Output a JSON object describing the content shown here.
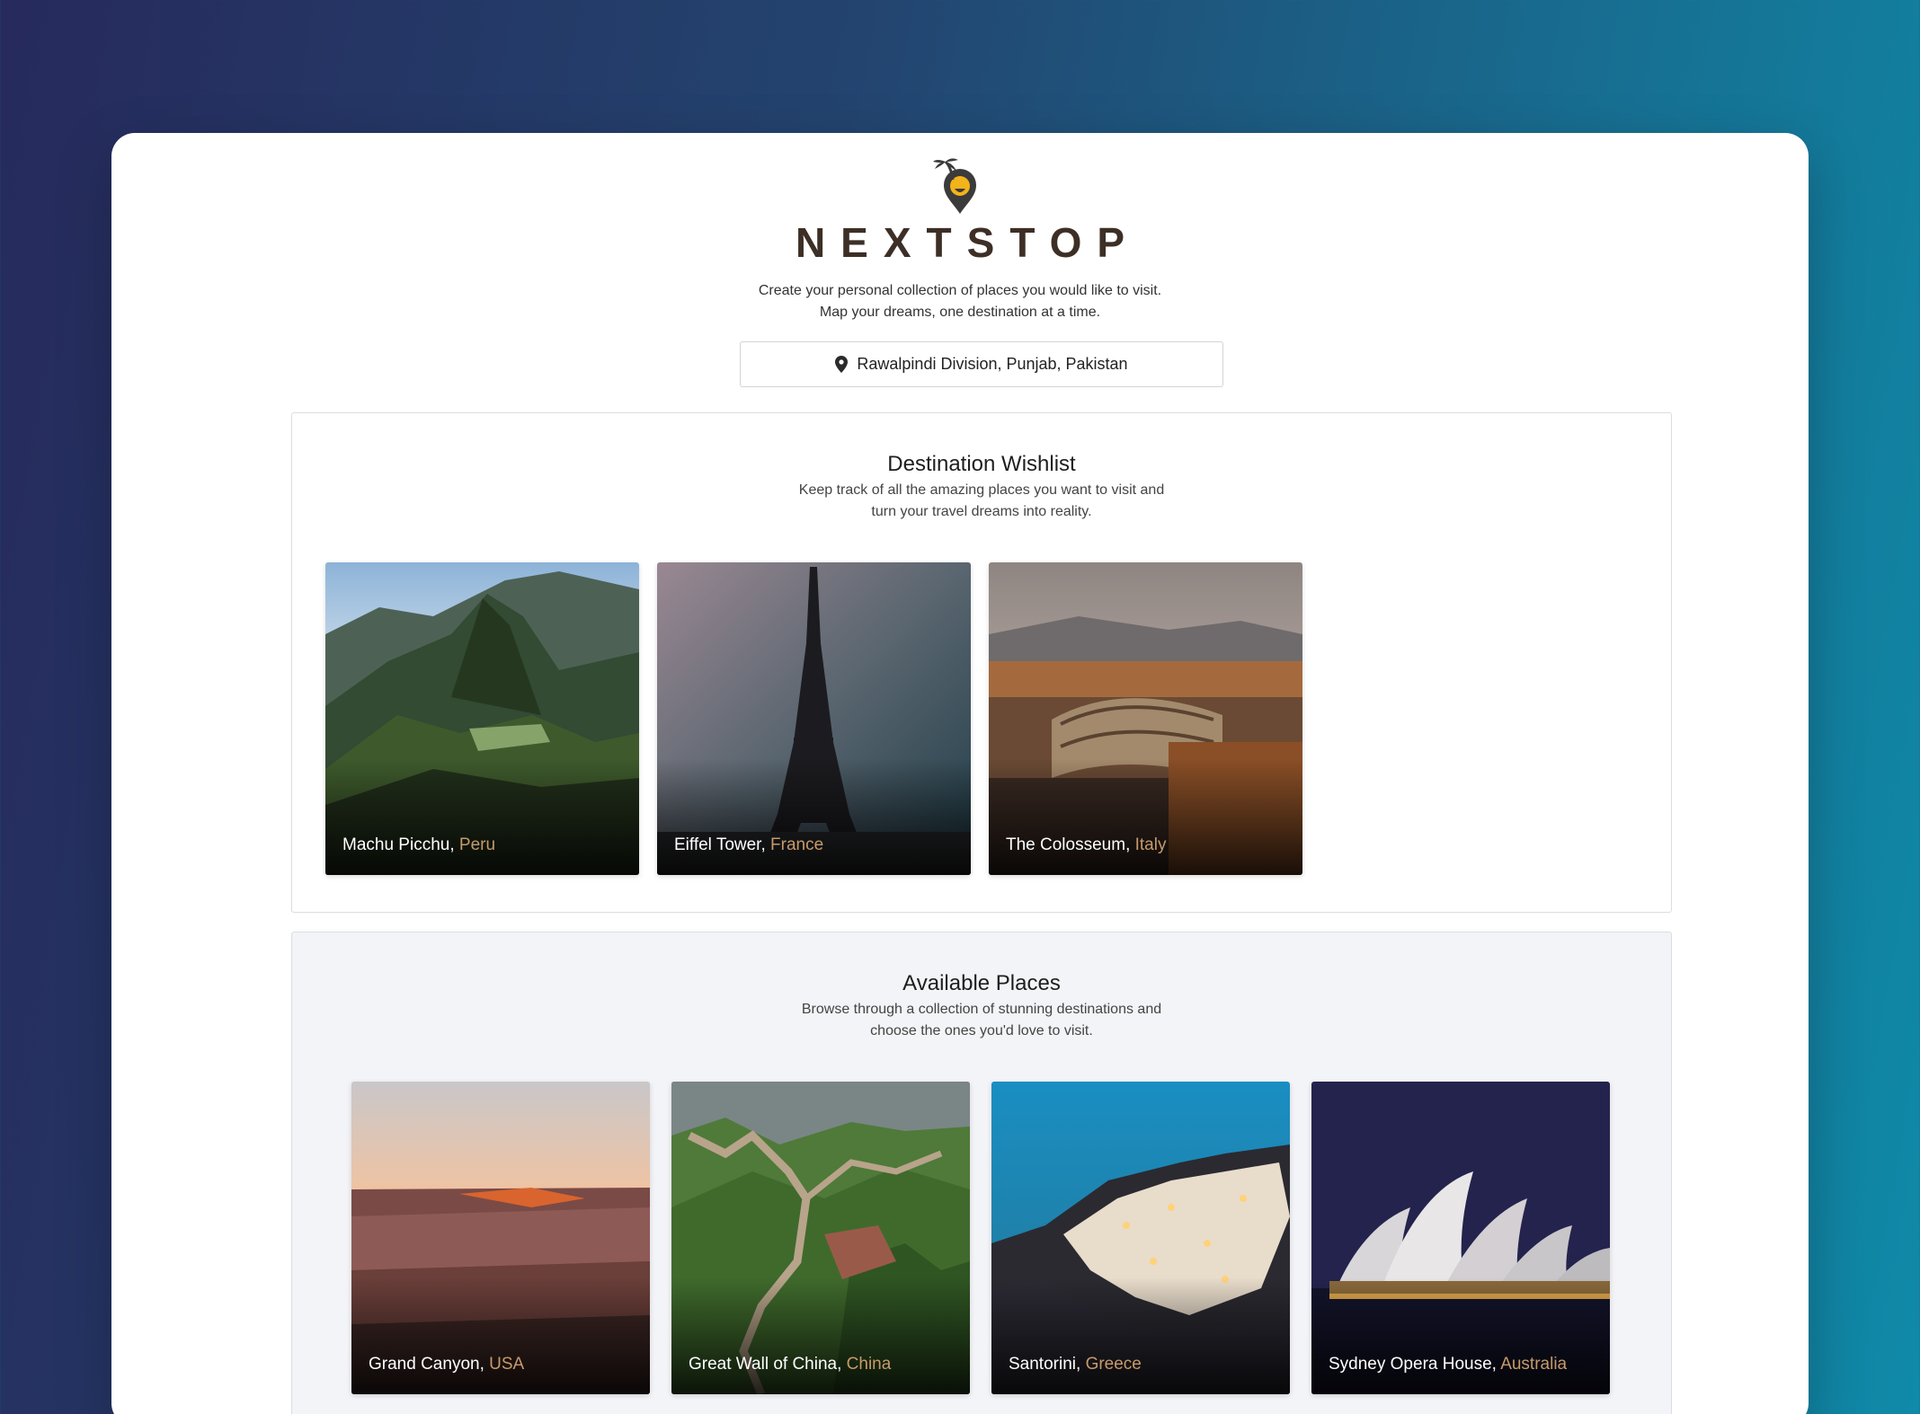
{
  "app": {
    "brand": "NEXTSTOP",
    "tagline_line1": "Create your personal collection of places you would like to visit.",
    "tagline_line2": "Map your dreams, one destination at a time.",
    "location": "Rawalpindi Division, Punjab, Pakistan",
    "logo_icon": "palm-pin-icon",
    "location_icon": "map-pin-icon"
  },
  "colors": {
    "brand_text": "#3d2f26",
    "country_accent": "#c79a6a",
    "logo_yellow": "#f3b31a",
    "logo_dark": "#3b3b3b"
  },
  "wishlist": {
    "title": "Destination Wishlist",
    "subtitle_line1": "Keep track of all the amazing places you want to visit and",
    "subtitle_line2": "turn your travel dreams into reality.",
    "places": [
      {
        "name": "Machu Picchu",
        "country": "Peru"
      },
      {
        "name": "Eiffel Tower",
        "country": "France"
      },
      {
        "name": "The Colosseum",
        "country": "Italy"
      }
    ]
  },
  "available": {
    "title": "Available Places",
    "subtitle_line1": "Browse through a collection of stunning destinations and",
    "subtitle_line2": "choose the ones you'd love to visit.",
    "places": [
      {
        "name": "Grand Canyon",
        "country": "USA"
      },
      {
        "name": "Great Wall of China",
        "country": "China"
      },
      {
        "name": "Santorini",
        "country": "Greece"
      },
      {
        "name": "Sydney Opera House",
        "country": "Australia"
      }
    ]
  }
}
